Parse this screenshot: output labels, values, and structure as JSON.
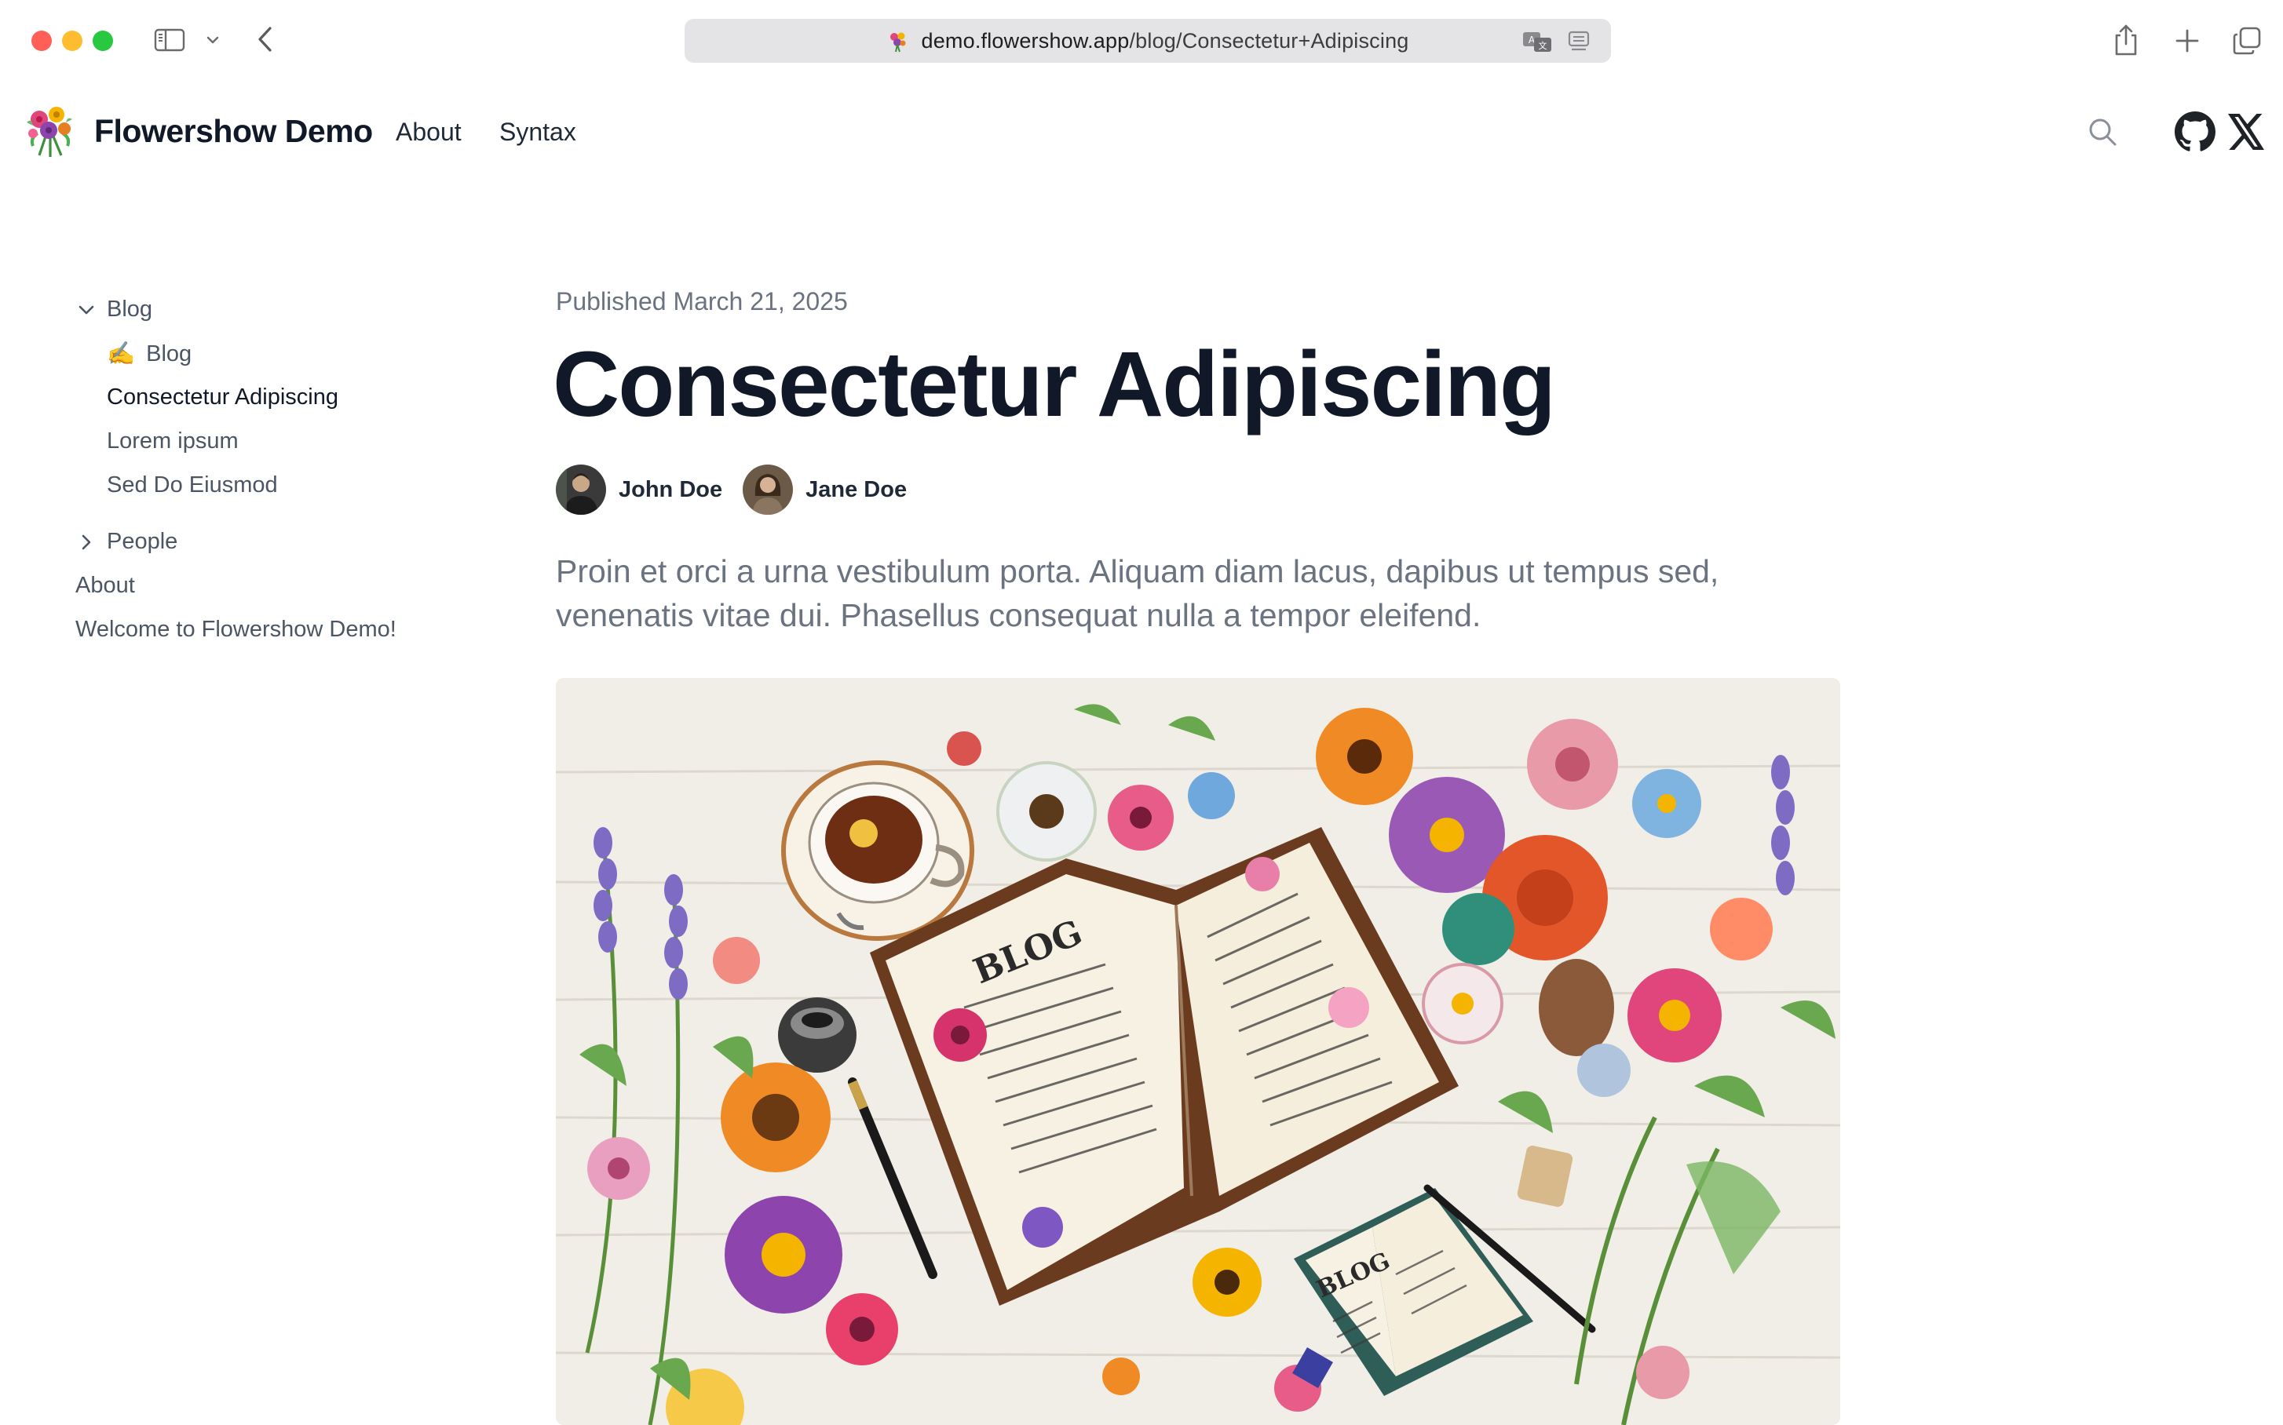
{
  "browser": {
    "url_host": "demo.flowershow.app",
    "url_path": "/blog/Consectetur+Adipiscing"
  },
  "site": {
    "title": "Flowershow Demo",
    "nav": {
      "about": "About",
      "syntax": "Syntax"
    }
  },
  "sidebar": {
    "blog_group": "Blog",
    "blog_index_emoji": "✍️",
    "blog_index": "Blog",
    "items": [
      "Consectetur Adipiscing",
      "Lorem ipsum",
      "Sed Do Eiusmod"
    ],
    "people_group": "People",
    "about": "About",
    "welcome": "Welcome to Flowershow Demo!"
  },
  "article": {
    "published": "Published March 21, 2025",
    "title": "Consectetur Adipiscing",
    "authors": [
      "John Doe",
      "Jane Doe"
    ],
    "lead": "Proin et orci a urna vestibulum porta. Aliquam diam lacus, dapibus ut tempus sed, venenatis vitae dui. Phasellus consequat nulla a tempor eleifend."
  },
  "hero_image": {
    "book_text_large": "BLOG",
    "book_text_small": "BLOG"
  },
  "icons": {
    "sidebar_toggle": "sidebar-icon",
    "back": "chevron-left-icon",
    "share": "share-icon",
    "new_tab": "plus-icon",
    "tabs": "tab-overview-icon",
    "search": "search-icon",
    "github": "github-icon",
    "x": "x-logo-icon"
  },
  "colors": {
    "traffic_red": "#ff5f57",
    "traffic_yellow": "#febc2e",
    "traffic_green": "#28c840",
    "text_primary": "#111827",
    "text_muted": "#6b7280"
  }
}
